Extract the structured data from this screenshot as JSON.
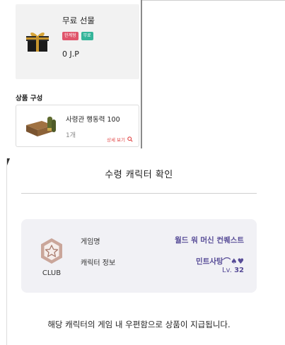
{
  "product": {
    "name": "무료 선물",
    "badges": [
      {
        "label": "한계형",
        "color": "#e0556b"
      },
      {
        "label": "무료",
        "color": "#35b59a"
      }
    ],
    "price": "0 J.P"
  },
  "composition": {
    "heading": "상품 구성",
    "items": [
      {
        "name": "사령관 행동력 100",
        "quantity": "1개",
        "detail_label": "상세 보기"
      }
    ]
  },
  "dialog": {
    "title": "수령 캐릭터 확인",
    "club_label": "CLUB",
    "game_label": "게임명",
    "game_value": "월드 워 머신 컨퀘스트",
    "character_label": "캐릭터 정보",
    "character_name": "민트사탕⌒♠♥",
    "level_prefix": "Lv.",
    "level_value": "32",
    "notice": "해당 캐릭터의 게임 내 우편함으로 상품이 지급됩니다."
  },
  "colors": {
    "accent": "#574c97",
    "badge_limit": "#e0556b",
    "badge_free": "#35b59a",
    "detail_link": "#e04545",
    "card_bg": "#f1f1f5"
  },
  "icons": [
    "gift-box-icon",
    "ammo-crate-icon",
    "search-icon",
    "club-badge-icon"
  ]
}
